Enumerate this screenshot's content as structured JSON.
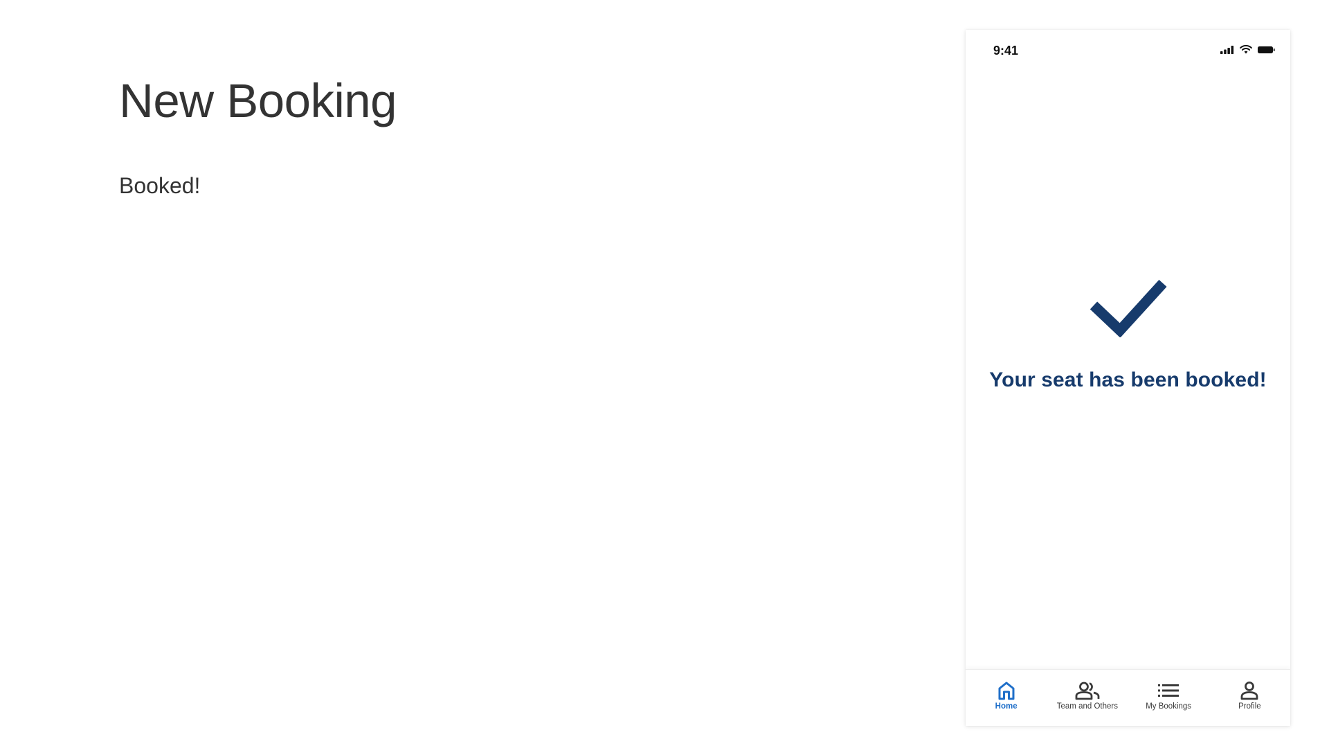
{
  "page": {
    "title": "New Booking",
    "subtitle": "Booked!"
  },
  "phone": {
    "status_bar": {
      "time": "9:41",
      "icons": [
        "cellular-signal-icon",
        "wifi-icon",
        "battery-icon"
      ]
    },
    "confirmation": {
      "icon": "checkmark-icon",
      "message": "Your seat has been booked!"
    },
    "tab_bar": {
      "tabs": [
        {
          "label": "Home",
          "icon": "home-icon",
          "active": true
        },
        {
          "label": "Team and Others",
          "icon": "people-icon",
          "active": false
        },
        {
          "label": "My Bookings",
          "icon": "list-icon",
          "active": false
        },
        {
          "label": "Profile",
          "icon": "person-icon",
          "active": false
        }
      ]
    }
  },
  "colors": {
    "brand_navy": "#173b6c",
    "active_tab": "#1f6fc9",
    "text": "#333333"
  }
}
